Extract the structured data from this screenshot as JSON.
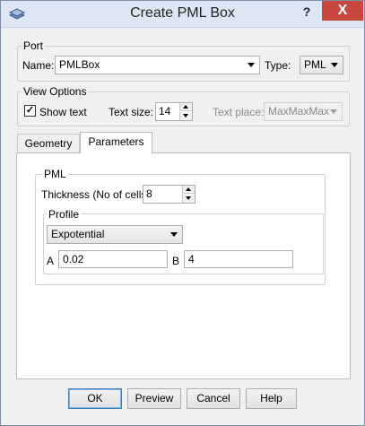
{
  "window": {
    "title": "Create PML Box",
    "help_glyph": "?",
    "close_glyph": "X"
  },
  "port": {
    "group_title": "Port",
    "name_label": "Name:",
    "name_value": "PMLBox",
    "type_label": "Type:",
    "type_value": "PML"
  },
  "view_options": {
    "group_title": "View Options",
    "show_text_label": "Show text",
    "show_text_checked": true,
    "text_size_label": "Text size:",
    "text_size_value": "14",
    "text_place_label": "Text place:",
    "text_place_value": "MaxMaxMax"
  },
  "tabs": [
    {
      "label": "Geometry",
      "active": false
    },
    {
      "label": "Parameters",
      "active": true
    }
  ],
  "pml": {
    "group_title": "PML",
    "thickness_label": "Thickness (No of cells)",
    "thickness_value": "8",
    "profile": {
      "group_title": "Profile",
      "profile_value": "Expotential",
      "a_label": "A",
      "a_value": "0.02",
      "b_label": "B",
      "b_value": "4"
    }
  },
  "buttons": {
    "ok": "OK",
    "preview": "Preview",
    "cancel": "Cancel",
    "help": "Help"
  },
  "icons": {
    "app_icon": "pml-box-app-icon",
    "checkmark": "✓"
  }
}
